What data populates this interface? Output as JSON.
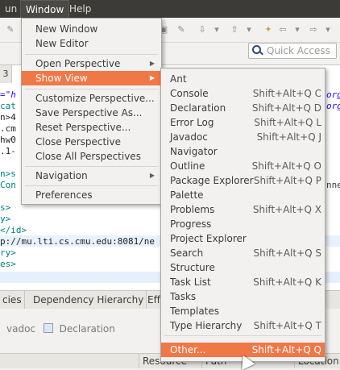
{
  "menubar": {
    "items": [
      "un",
      "Window",
      "Help"
    ]
  },
  "quick_access": {
    "placeholder": "Quick Access"
  },
  "editor": {
    "tab_label": "3",
    "left_lines": [
      "=\"h",
      "cat",
      "n>4",
      ".cm",
      "hw0",
      ".1-",
      "",
      "n>s",
      "Con"
    ],
    "right_lines": [
      "org",
      "org"
    ],
    "right_tail": "nne",
    "lower_lines": [
      "s>",
      "y>",
      "</id>",
      "p://mu.lti.cs.cmu.edu:8081/ne",
      "ry>",
      "es>"
    ]
  },
  "bottom_tabs": [
    "cies",
    "Dependency Hierarchy",
    "Effecti"
  ],
  "lower_panel": {
    "javadoc": "vadoc",
    "declaration": "Declaration"
  },
  "columns": [
    "Resource",
    "Path",
    "Location"
  ],
  "window_menu": [
    {
      "label": "New Window"
    },
    {
      "label": "New Editor"
    },
    {
      "label": "Open Perspective",
      "submenu": true
    },
    {
      "label": "Show View",
      "submenu": true,
      "selected": true
    },
    {
      "label": "Customize Perspective..."
    },
    {
      "label": "Save Perspective As..."
    },
    {
      "label": "Reset Perspective..."
    },
    {
      "label": "Close Perspective"
    },
    {
      "label": "Close All Perspectives"
    },
    {
      "label": "Navigation",
      "submenu": true
    },
    {
      "label": "Preferences"
    }
  ],
  "show_view_menu": [
    {
      "label": "Ant",
      "shortcut": ""
    },
    {
      "label": "Console",
      "shortcut": "Shift+Alt+Q C"
    },
    {
      "label": "Declaration",
      "shortcut": "Shift+Alt+Q D"
    },
    {
      "label": "Error Log",
      "shortcut": "Shift+Alt+Q L"
    },
    {
      "label": "Javadoc",
      "shortcut": "Shift+Alt+Q J"
    },
    {
      "label": "Navigator",
      "shortcut": ""
    },
    {
      "label": "Outline",
      "shortcut": "Shift+Alt+Q O"
    },
    {
      "label": "Package Explorer",
      "shortcut": "Shift+Alt+Q P"
    },
    {
      "label": "Palette",
      "shortcut": ""
    },
    {
      "label": "Problems",
      "shortcut": "Shift+Alt+Q X"
    },
    {
      "label": "Progress",
      "shortcut": ""
    },
    {
      "label": "Project Explorer",
      "shortcut": ""
    },
    {
      "label": "Search",
      "shortcut": "Shift+Alt+Q S"
    },
    {
      "label": "Structure",
      "shortcut": ""
    },
    {
      "label": "Task List",
      "shortcut": "Shift+Alt+Q K"
    },
    {
      "label": "Tasks",
      "shortcut": ""
    },
    {
      "label": "Templates",
      "shortcut": ""
    },
    {
      "label": "Type Hierarchy",
      "shortcut": "Shift+Alt+Q T"
    },
    {
      "label": "Other...",
      "shortcut": "Shift+Alt+Q Q",
      "selected": true
    }
  ],
  "colors": {
    "accent": "#f07746",
    "menubar": "#3c3b37",
    "menu_bg": "#f2f1f0"
  }
}
